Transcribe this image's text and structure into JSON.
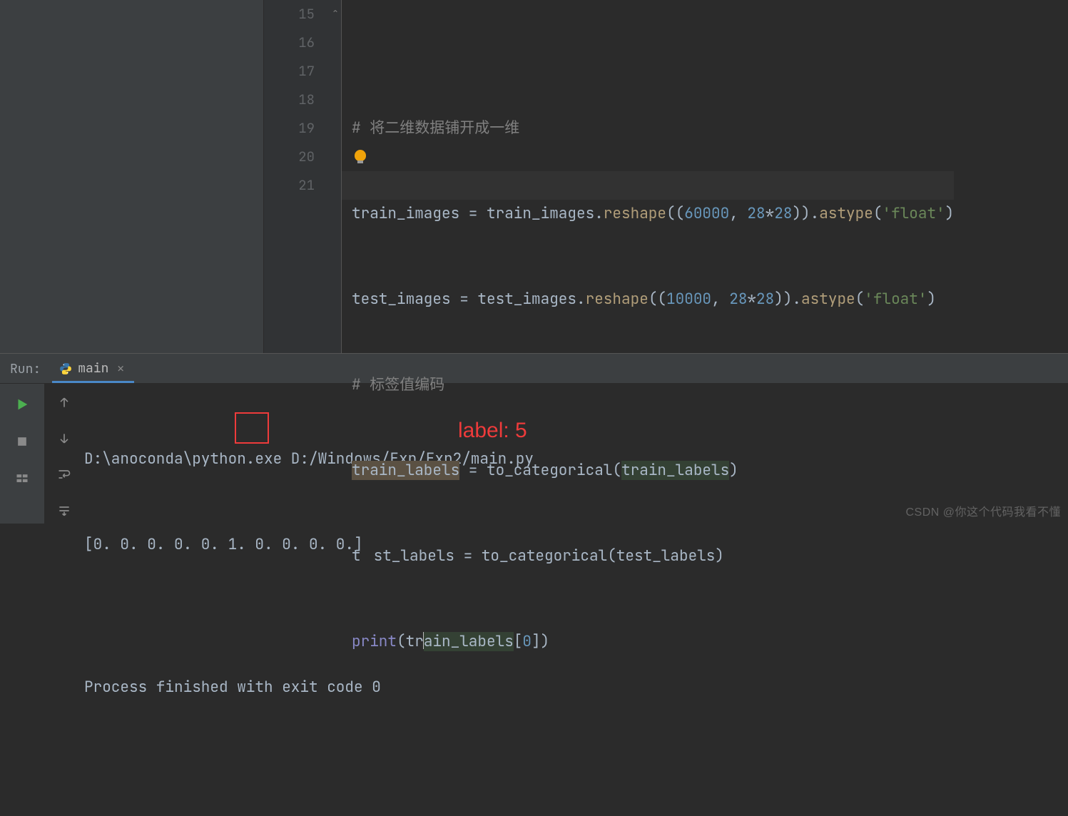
{
  "gutter": {
    "l0": "15",
    "l1": "16",
    "l2": "17",
    "l3": "18",
    "l4": "19",
    "l5": "20",
    "l6": "21"
  },
  "code": {
    "l15_comment": "# 将二维数据铺开成一维",
    "l16": {
      "a": "train_images = train_images.",
      "fn": "reshape",
      "p1": "((",
      "n1": "60000",
      "c": ", ",
      "n2": "28",
      "star": "*",
      "n2b": "28",
      "p2": ")).",
      "fn2": "astype",
      "p3": "(",
      "s": "'float'",
      "p4": ")"
    },
    "l17": {
      "a": "test_images = test_images.",
      "fn": "reshape",
      "p1": "((",
      "n1": "10000",
      "c": ", ",
      "n2": "28",
      "star": "*",
      "n2b": "28",
      "p2": ")).",
      "fn2": "astype",
      "p3": "(",
      "s": "'float'",
      "p4": ")"
    },
    "l18_comment": "# 标签值编码",
    "l19": {
      "a": "train_labels",
      "b": " = to_categorical(",
      "c": "train_labels",
      "d": ")"
    },
    "l20": {
      "a": "t",
      "b": "st_labels = to_categorical(test_labels)"
    },
    "l21": {
      "a": "print",
      "b": "(tr",
      "c": "",
      "d": "ain_labels",
      "e": "[",
      "n": "0",
      "f": "])"
    }
  },
  "run": {
    "label": "Run:",
    "tabName": "main",
    "out1": "D:\\anoconda\\python.exe D:/Windows/Exp/Exp2/main.py",
    "out2": "[0. 0. 0. 0. 0. 1. 0. 0. 0. 0.]",
    "out3": "",
    "out4": "Process finished with exit code 0"
  },
  "annotation": "label: 5",
  "watermark": "CSDN @你这个代码我看不懂"
}
